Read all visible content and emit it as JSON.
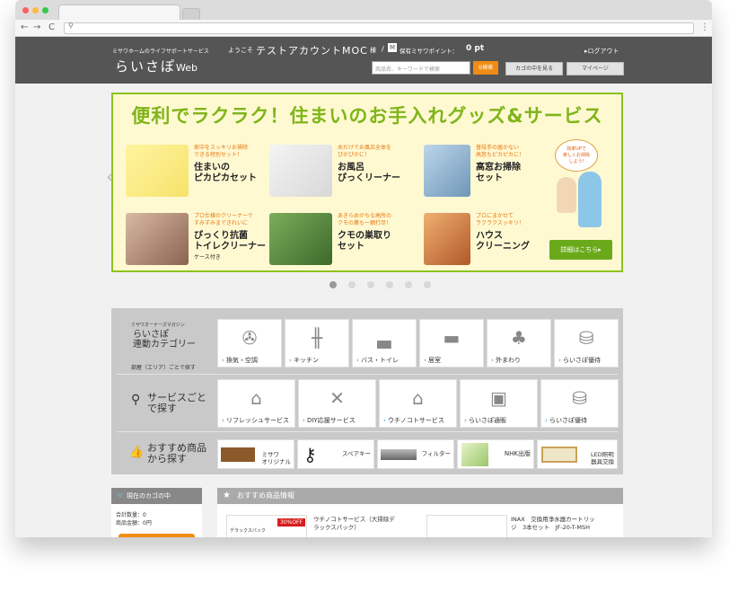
{
  "browser": {
    "url_icon": "search-icon",
    "nav_back": "←",
    "nav_forward": "→",
    "nav_reload": "C",
    "menu": "⋮"
  },
  "header": {
    "tagline": "ミサワホームのライフサポートサービス",
    "welcome": "ようこそ",
    "account_name": "テストアカウントMOC",
    "honorific": "様",
    "separator": "/",
    "m_badge": "M",
    "points_label": "保有ミサワポイント：",
    "points_value": "0 pt",
    "logout": "▸ログアウト",
    "logo": "らいさぽ",
    "logo_suffix": "Web",
    "search_placeholder": "商品名、キーワードで検索",
    "search_button": "検索",
    "cart_button": "カゴの中を見る",
    "mypage_button": "マイページ"
  },
  "banner": {
    "title": "便利でラクラク！住まいのお手入れグッズ&サービス",
    "items": [
      {
        "sub": "家中をスッキリお掃除\nできる特別セット！",
        "name": "住まいの\nピカピカセット"
      },
      {
        "sub": "水だけでお風呂全体を\nぴかぴかに！",
        "name": "お風呂\nぴっくリーナー"
      },
      {
        "sub": "普段手の届かない\n高窓もピカピカに！",
        "name": "高窓お掃除\nセット"
      },
      {
        "sub": "プロ仕様のクリーナーで\nすみずみまできれいに",
        "name": "ぴっくり抗菌\nトイレクリーナー",
        "note": "ケース付き"
      },
      {
        "sub": "あきらめがちな高所の\nクモの巣も一網打尽！",
        "name": "クモの巣取り\nセット"
      },
      {
        "sub": "プロにまかせて\nラクラクスッキリ！",
        "name": "ハウス\nクリーニング"
      }
    ],
    "bubble": "効率UPで\n楽しくお掃除\nしよう!",
    "detail": "詳細はこちら▸",
    "prev": "‹",
    "next": "›"
  },
  "categories": {
    "row1": {
      "magazine": "ミサワオーナーズマガジン",
      "title": "らいさぽ\n連動カテゴリー",
      "sub": "部屋（エリア）ごとで探す",
      "tiles": [
        {
          "label": "換気・空調",
          "icon": "fan-icon"
        },
        {
          "label": "キッチン",
          "icon": "fork-knife-icon"
        },
        {
          "label": "バス・トイレ",
          "icon": "bathtub-icon"
        },
        {
          "label": "居室",
          "icon": "sofa-icon"
        },
        {
          "label": "外まわり",
          "icon": "tree-icon"
        },
        {
          "label": "らいさぽ優待",
          "icon": "bag-icon"
        }
      ]
    },
    "row2": {
      "title": "サービスごと\nで探す",
      "tiles": [
        {
          "label": "リフレッシュサービス",
          "icon": "house-refresh-icon"
        },
        {
          "label": "DIY応援サービス",
          "icon": "tools-icon"
        },
        {
          "label": "ウチノコトサービス",
          "icon": "home-icon"
        },
        {
          "label": "らいさぽ通販",
          "icon": "box-icon"
        },
        {
          "label": "らいさぽ優待",
          "icon": "bag-icon"
        }
      ]
    },
    "row3": {
      "title": "おすすめ商品\nから探す",
      "tiles": [
        {
          "label": "ミサワ\nオリジナル",
          "icon": "furniture-icon"
        },
        {
          "label": "スペアキー",
          "icon": "key-icon"
        },
        {
          "label": "フィルター",
          "icon": "filter-icon"
        },
        {
          "label": "NHK出版",
          "icon": "book-icon"
        },
        {
          "label": "LED照明\n器具交換",
          "icon": "led-icon"
        }
      ]
    }
  },
  "sidebar": {
    "title": "現在のカゴの中",
    "count_label": "合計数量：0",
    "amount_label": "商品金額：0円"
  },
  "recommend": {
    "title": "おすすめ商品情報",
    "badge": "30%OFF",
    "pack_label": "デラックスパック",
    "item1": "ウチノコトサービス（大掃除デ\nラックスパック）",
    "item2": "INAX　交換用浄水器カートリッ\nジ　3本セット　JF-20-T-MSH"
  },
  "colors": {
    "header_bg": "#555555",
    "accent": "#f08c14",
    "banner_green": "#8dc21f",
    "link": "#3a8fd0"
  }
}
